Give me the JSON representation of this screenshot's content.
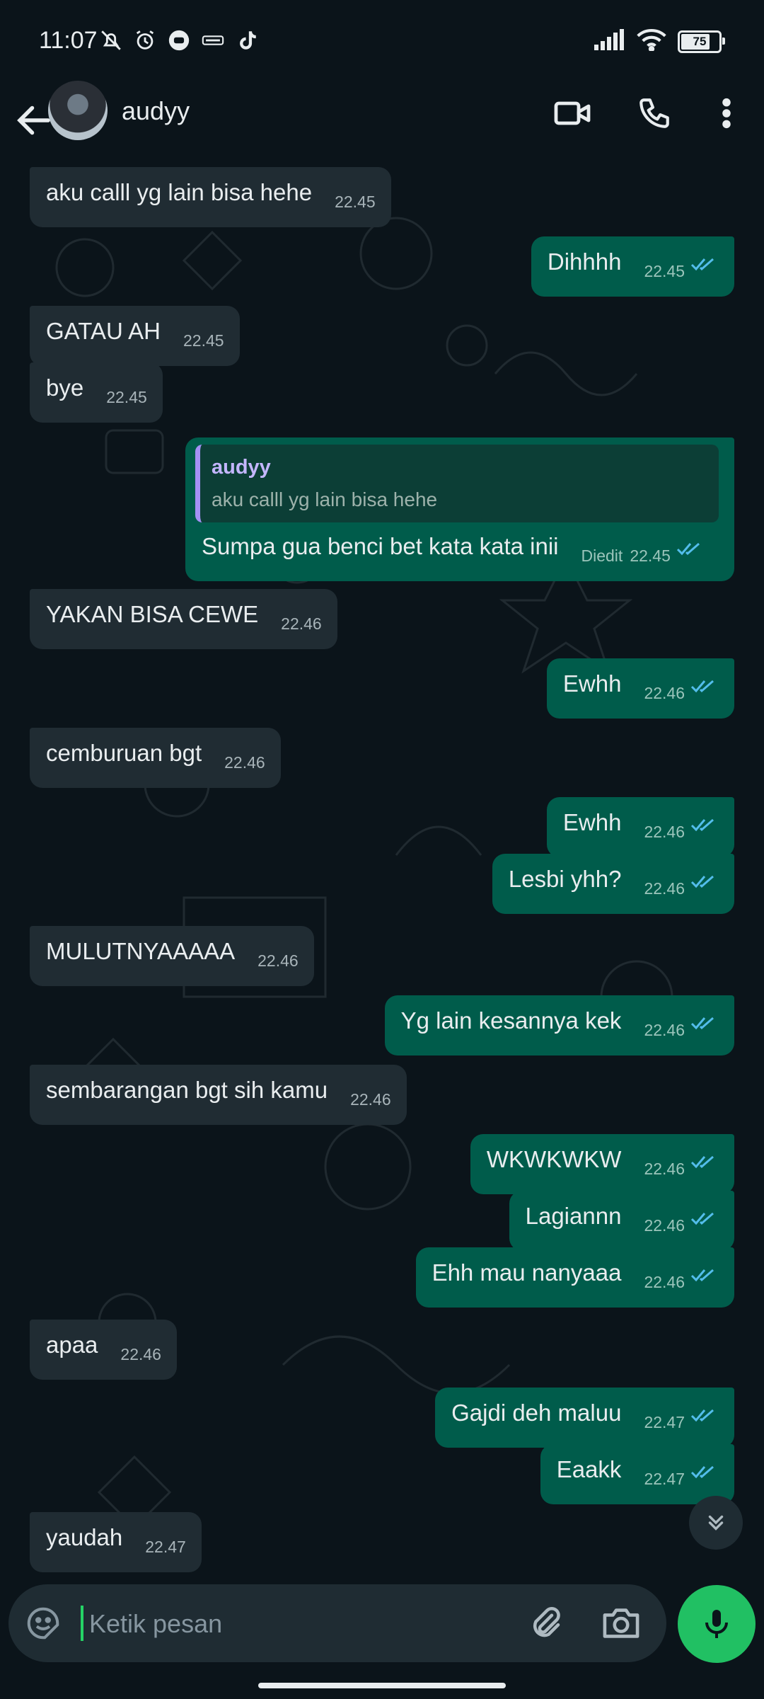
{
  "status_bar": {
    "time": "11:07",
    "battery": "75",
    "icons_left": [
      "mute-icon",
      "alarm-icon",
      "app-icon",
      "bca-icon",
      "tiktok-icon"
    ],
    "icons_right": [
      "signal-icon",
      "wifi-icon",
      "battery-icon"
    ]
  },
  "header": {
    "contact_name": "audyy",
    "actions": [
      "video-call-icon",
      "voice-call-icon",
      "more-icon"
    ]
  },
  "colors": {
    "background": "#0b141a",
    "incoming_bubble": "#202c33",
    "outgoing_bubble": "#005c4b",
    "read_ticks": "#53bdeb",
    "accent": "#21c063"
  },
  "messages": [
    {
      "dir": "in",
      "text": "aku calll yg lain bisa hehe",
      "time": "22.45"
    },
    {
      "dir": "out",
      "text": "Dihhhh",
      "time": "22.45",
      "status": "read"
    },
    {
      "dir": "in",
      "text": "GATAU AH",
      "time": "22.45"
    },
    {
      "dir": "in",
      "text": "bye",
      "time": "22.45"
    },
    {
      "dir": "out",
      "text": "Sumpa gua benci bet kata kata inii",
      "time": "22.45",
      "status": "read",
      "edited": "Diedit",
      "reply": {
        "name": "audyy",
        "text": "aku calll yg lain bisa hehe"
      }
    },
    {
      "dir": "in",
      "text": "YAKAN BISA CEWE",
      "time": "22.46"
    },
    {
      "dir": "out",
      "text": "Ewhh",
      "time": "22.46",
      "status": "read"
    },
    {
      "dir": "in",
      "text": "cemburuan bgt",
      "time": "22.46"
    },
    {
      "dir": "out",
      "text": "Ewhh",
      "time": "22.46",
      "status": "read"
    },
    {
      "dir": "out",
      "text": "Lesbi yhh?",
      "time": "22.46",
      "status": "read"
    },
    {
      "dir": "in",
      "text": "MULUTNYAAAAA",
      "time": "22.46"
    },
    {
      "dir": "out",
      "text": "Yg lain kesannya kek",
      "time": "22.46",
      "status": "read"
    },
    {
      "dir": "in",
      "text": "sembarangan bgt sih kamu",
      "time": "22.46"
    },
    {
      "dir": "out",
      "text": "WKWKWKW",
      "time": "22.46",
      "status": "read"
    },
    {
      "dir": "out",
      "text": "Lagiannn",
      "time": "22.46",
      "status": "read"
    },
    {
      "dir": "out",
      "text": "Ehh mau nanyaaa",
      "time": "22.46",
      "status": "read"
    },
    {
      "dir": "in",
      "text": "apaa",
      "time": "22.46"
    },
    {
      "dir": "out",
      "text": "Gajdi deh maluu",
      "time": "22.47",
      "status": "read"
    },
    {
      "dir": "out",
      "text": "Eaakk",
      "time": "22.47",
      "status": "read"
    },
    {
      "dir": "in",
      "text": "yaudah",
      "time": "22.47"
    }
  ],
  "composer": {
    "placeholder": "Ketik pesan",
    "value": ""
  }
}
